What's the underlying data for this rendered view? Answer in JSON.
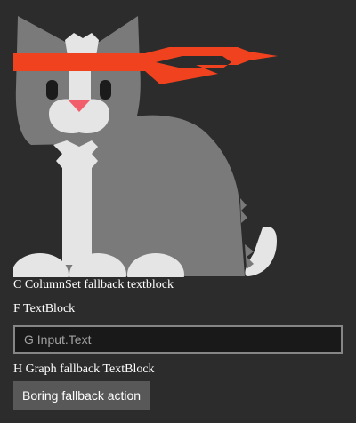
{
  "card": {
    "image": {
      "icon": "ninja-cat-image"
    },
    "columnset_fallback_text": "C ColumnSet fallback textblock",
    "textblock_f": "F TextBlock",
    "input": {
      "placeholder": "G Input.Text",
      "value": ""
    },
    "graph_fallback_text": "H Graph fallback TextBlock",
    "fallback_action_label": "Boring fallback action"
  },
  "colors": {
    "background": "#2c2c2c",
    "cat_body": "#7a7a7a",
    "cat_light": "#e5e5e5",
    "headband": "#f0421e",
    "nose": "#f25d6b",
    "input_border": "#868686",
    "input_background": "#191919",
    "action_background": "#585858"
  }
}
